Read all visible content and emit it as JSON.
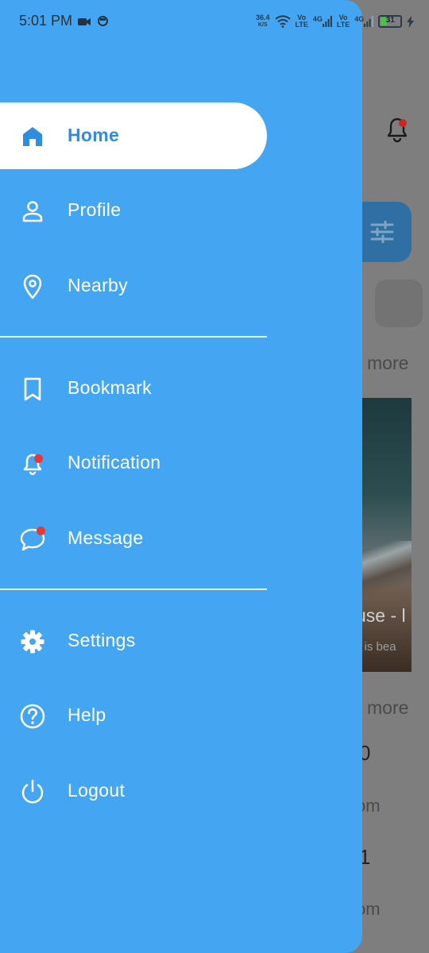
{
  "status_bar": {
    "time": "5:01 PM",
    "net_speed": "36.4",
    "net_unit": "K/S",
    "sim1_vo": "Vo",
    "sim1_lte": "LTE",
    "sim1_4g": "4G",
    "sim2_vo": "Vo",
    "sim2_lte": "LTE",
    "sim2_4g": "4G",
    "battery": "31",
    "battery_level": 0.31,
    "battery_color": "#47c447"
  },
  "drawer": {
    "background_color": "#44a5f3",
    "active_color": "#2f8ddf",
    "items_group1": [
      {
        "label": "Home",
        "icon": "home-icon",
        "active": true
      },
      {
        "label": "Profile",
        "icon": "person-icon"
      },
      {
        "label": "Nearby",
        "icon": "location-pin-icon"
      }
    ],
    "items_group2": [
      {
        "label": "Bookmark",
        "icon": "bookmark-icon"
      },
      {
        "label": "Notification",
        "icon": "bell-icon",
        "badge": true
      },
      {
        "label": "Message",
        "icon": "chat-bubble-icon",
        "badge": true
      }
    ],
    "items_group3": [
      {
        "label": "Settings",
        "icon": "gear-icon"
      },
      {
        "label": "Help",
        "icon": "help-circle-icon"
      },
      {
        "label": "Logout",
        "icon": "power-icon"
      }
    ]
  },
  "background": {
    "more_label_1": "more",
    "card_title_partial": "use - l",
    "card_subtitle_partial": "e is bea",
    "more_label_2": "more",
    "number_1": "0",
    "small_1": "om",
    "number_2": "1",
    "small_2": "om"
  }
}
